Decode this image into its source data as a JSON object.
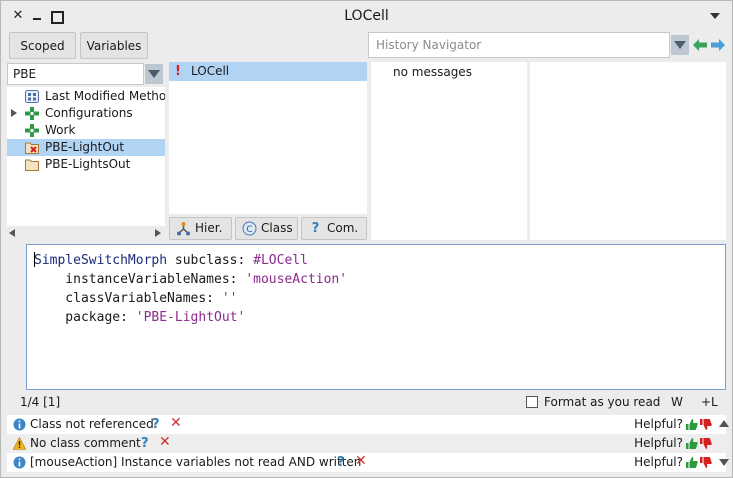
{
  "window": {
    "title": "LOCell"
  },
  "toolbar": {
    "scoped_label": "Scoped",
    "variables_label": "Variables",
    "history_placeholder": "History Navigator"
  },
  "packages": {
    "filter_value": "PBE",
    "items": [
      {
        "label": "Last Modified Methods",
        "icon": "clock-grid-icon",
        "expandable": false,
        "selected": false
      },
      {
        "label": "Configurations",
        "icon": "package-cross-icon",
        "expandable": true,
        "selected": false
      },
      {
        "label": "Work",
        "icon": "package-cross-icon",
        "expandable": false,
        "selected": false
      },
      {
        "label": "PBE-LightOut",
        "icon": "package-folder-error-icon",
        "expandable": false,
        "selected": true
      },
      {
        "label": "PBE-LightsOut",
        "icon": "package-folder-icon",
        "expandable": false,
        "selected": false
      }
    ]
  },
  "classes": {
    "items": [
      {
        "label": "LOCell",
        "flag": "!",
        "selected": true
      }
    ],
    "segments": {
      "hier": "Hier.",
      "class": "Class",
      "com": "Com."
    }
  },
  "protocols": {
    "items": [
      "no messages"
    ]
  },
  "editor": {
    "lines": [
      [
        {
          "t": "SimpleSwitchMorph",
          "c": "ident"
        },
        {
          "t": " subclass: ",
          "c": "plain"
        },
        {
          "t": "#LOCell",
          "c": "sym"
        }
      ],
      [
        {
          "t": "    instanceVariableNames: ",
          "c": "plain"
        },
        {
          "t": "'mouseAction'",
          "c": "str"
        }
      ],
      [
        {
          "t": "    classVariableNames: ",
          "c": "plain"
        },
        {
          "t": "''",
          "c": "str"
        }
      ],
      [
        {
          "t": "    package: ",
          "c": "plain"
        },
        {
          "t": "'PBE-LightOut'",
          "c": "str"
        }
      ]
    ]
  },
  "status": {
    "position": "1/4 [1]",
    "format_label": "Format as you read",
    "format_checked": false,
    "w_label": "W",
    "l_label": "+L"
  },
  "critics": {
    "help_label": "Helpful?",
    "items": [
      {
        "text": "Class not referenced",
        "icon": "info-icon"
      },
      {
        "text": "No class comment",
        "icon": "warning-icon"
      },
      {
        "text": "[mouseAction] Instance variables not read AND written",
        "icon": "info-icon"
      }
    ]
  },
  "colors": {
    "selection": "#b1d4f5",
    "identifier": "#1a2c7a",
    "symbol_string": "#8b2a8c",
    "error_flag": "#d42020",
    "nav_arrows": "#3aa35a"
  }
}
